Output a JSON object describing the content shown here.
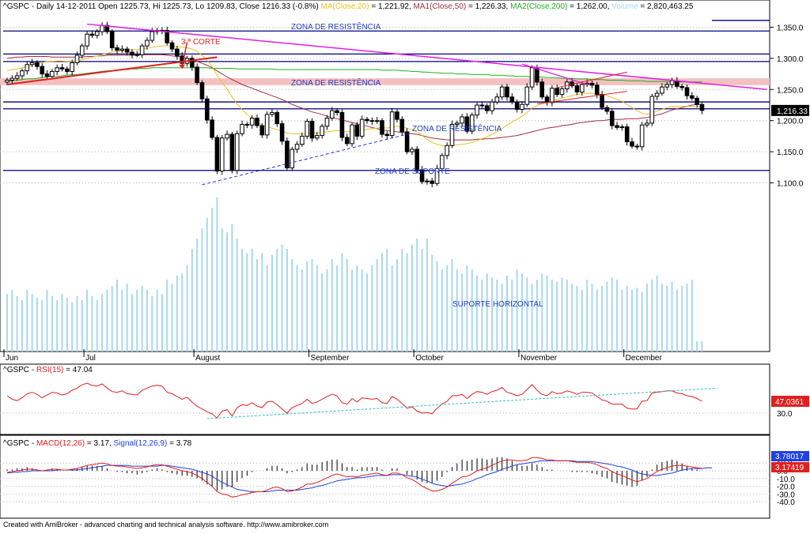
{
  "header": {
    "price": {
      "symbol": "^GSPC",
      "sep1": " - ",
      "period": "Daily",
      "date": "14-12-2011",
      "open": "Open 1225.73,",
      "hi": "Hi 1225.73,",
      "lo": "Lo 1209.83,",
      "close": "Close 1216.33 (-0.8%)",
      "ma": "MA(Close,20)",
      "ma_val": "= 1,221.92,",
      "ma1": "MA1(Close,50)",
      "ma1_val": "= 1,226.33,",
      "ma2": "MA2(Close,200)",
      "ma2_val": "= 1,262.00,",
      "vol": "Volume",
      "vol_val": "= 2,820,463.25"
    },
    "rsi": {
      "symbol": "^GSPC",
      "sep": " - ",
      "label": "RSI(15)",
      "val": "= 47.04"
    },
    "macd": {
      "symbol": "^GSPC",
      "sep": " - ",
      "label": "MACD(12,26)",
      "val": "= 3.17,",
      "sig": "Signal(12,26,9)",
      "sig_val": "= 3.78"
    }
  },
  "colors": {
    "candle": "#000000",
    "ma20": "#e8c020",
    "ma50": "#a03040",
    "ma200": "#20b020",
    "volume": "#a8d8f0",
    "resistance_line": "#000080",
    "trend_pink": "#e020e0",
    "trend_red": "#e02020",
    "zone_fill": "#f4c0c0",
    "rsi": "#e02020",
    "rsi_trend": "#30c0c0",
    "macd": "#e02020",
    "signal": "#2040e0",
    "hist": "#000000"
  },
  "annotations": {
    "zone_res_1": "ZONA DE RESISTÊNCIA",
    "zone_res_2": "ZONA DE RESISTÊNCIA",
    "zone_res_3": "ZONA DE RESISTÊNCIA",
    "zone_sup": "ZONA DE SUPORTE",
    "sup_horiz": "SUPORTE HORIZONTAL",
    "corte": "3.ª CORTE"
  },
  "footer": "Created with AmiBroker - advanced charting and technical analysis software. http://www.amibroker.com",
  "chart_data": [
    {
      "type": "candlestick",
      "pane": "price",
      "ylim": [
        1070,
        1370
      ],
      "yticks": [
        "1,350.0",
        "1,300.0",
        "1,250.0",
        "1,200.0",
        "1,150.0",
        "1,100.0"
      ],
      "ytick_values": [
        1350,
        1300,
        1250,
        1200,
        1150,
        1100
      ],
      "last_price_label": "1,216.33",
      "last_price": 1216.33,
      "month_labels": [
        "Jun",
        "Jul",
        "August",
        "September",
        "October",
        "November",
        "December"
      ],
      "month_start_index": [
        0,
        16,
        38,
        61,
        82,
        103,
        124
      ],
      "closes": [
        1265,
        1268,
        1272,
        1280,
        1290,
        1293,
        1287,
        1275,
        1271,
        1279,
        1285,
        1283,
        1279,
        1293,
        1305,
        1320,
        1339,
        1337,
        1343,
        1353,
        1343,
        1317,
        1313,
        1315,
        1310,
        1306,
        1306,
        1320,
        1329,
        1343,
        1345,
        1345,
        1325,
        1315,
        1304,
        1292,
        1300,
        1286,
        1261,
        1235,
        1201,
        1173,
        1119,
        1172,
        1178,
        1120,
        1179,
        1194,
        1193,
        1204,
        1192,
        1177,
        1210,
        1213,
        1195,
        1167,
        1124,
        1154,
        1162,
        1175,
        1199,
        1172,
        1176,
        1191,
        1204,
        1216,
        1213,
        1173,
        1163,
        1193,
        1175,
        1202,
        1200,
        1199,
        1200,
        1178,
        1176,
        1214,
        1202,
        1182,
        1150,
        1154,
        1121,
        1102,
        1103,
        1099,
        1123,
        1144,
        1160,
        1194,
        1196,
        1206,
        1183,
        1209,
        1225,
        1224,
        1216,
        1230,
        1238,
        1254,
        1238,
        1230,
        1218,
        1226,
        1254,
        1285,
        1262,
        1238,
        1229,
        1252,
        1242,
        1251,
        1262,
        1256,
        1246,
        1258,
        1260,
        1257,
        1242,
        1221,
        1215,
        1192,
        1189,
        1190,
        1166,
        1159,
        1158,
        1193,
        1196,
        1239,
        1244,
        1254,
        1258,
        1264,
        1255,
        1253,
        1240,
        1236,
        1226,
        1216.33
      ],
      "ma20": [
        1280,
        1282,
        1283,
        1285,
        1287,
        1290,
        1292,
        1293,
        1295,
        1295,
        1296,
        1296,
        1295,
        1295,
        1296,
        1298,
        1300,
        1302,
        1304,
        1306,
        1308,
        1310,
        1311,
        1312,
        1313,
        1314,
        1314,
        1315,
        1316,
        1318,
        1319,
        1320,
        1320,
        1320,
        1319,
        1318,
        1317,
        1315,
        1311,
        1305,
        1297,
        1287,
        1273,
        1261,
        1251,
        1238,
        1227,
        1218,
        1210,
        1204,
        1198,
        1192,
        1190,
        1188,
        1186,
        1183,
        1180,
        1179,
        1179,
        1178,
        1179,
        1180,
        1180,
        1181,
        1182,
        1183,
        1184,
        1183,
        1182,
        1182,
        1182,
        1184,
        1186,
        1187,
        1188,
        1189,
        1188,
        1190,
        1191,
        1190,
        1188,
        1186,
        1182,
        1176,
        1170,
        1165,
        1162,
        1160,
        1159,
        1160,
        1161,
        1162,
        1163,
        1165,
        1168,
        1171,
        1174,
        1178,
        1182,
        1187,
        1193,
        1198,
        1202,
        1207,
        1213,
        1220,
        1224,
        1227,
        1229,
        1232,
        1234,
        1236,
        1238,
        1240,
        1242,
        1243,
        1244,
        1244,
        1243,
        1242,
        1240,
        1237,
        1234,
        1231,
        1226,
        1221,
        1216,
        1212,
        1210,
        1212,
        1215,
        1218,
        1221,
        1223,
        1223,
        1223,
        1223,
        1223,
        1222,
        1221.92
      ],
      "ma50": [
        1300,
        1301,
        1302,
        1302,
        1303,
        1303,
        1303,
        1303,
        1303,
        1302,
        1302,
        1302,
        1302,
        1302,
        1302,
        1302,
        1303,
        1303,
        1304,
        1304,
        1305,
        1305,
        1305,
        1305,
        1305,
        1305,
        1305,
        1306,
        1306,
        1306,
        1306,
        1306,
        1305,
        1304,
        1303,
        1302,
        1300,
        1298,
        1295,
        1292,
        1289,
        1285,
        1280,
        1275,
        1270,
        1266,
        1262,
        1258,
        1255,
        1252,
        1249,
        1246,
        1243,
        1240,
        1237,
        1234,
        1230,
        1226,
        1223,
        1220,
        1217,
        1214,
        1212,
        1210,
        1207,
        1205,
        1203,
        1201,
        1199,
        1197,
        1195,
        1193,
        1191,
        1189,
        1187,
        1185,
        1184,
        1183,
        1182,
        1181,
        1180,
        1179,
        1178,
        1176,
        1174,
        1172,
        1171,
        1170,
        1169,
        1169,
        1169,
        1169,
        1169,
        1169,
        1170,
        1170,
        1171,
        1171,
        1172,
        1173,
        1174,
        1175,
        1176,
        1178,
        1180,
        1182,
        1184,
        1186,
        1188,
        1189,
        1190,
        1192,
        1193,
        1194,
        1196,
        1197,
        1198,
        1199,
        1200,
        1200,
        1201,
        1202,
        1202,
        1202,
        1203,
        1203,
        1203,
        1204,
        1205,
        1207,
        1209,
        1211,
        1214,
        1217,
        1219,
        1221,
        1223,
        1225,
        1226,
        1226.33
      ],
      "ma200": [
        1263,
        1264,
        1265,
        1266,
        1267,
        1267,
        1268,
        1269,
        1270,
        1271,
        1271,
        1272,
        1273,
        1274,
        1274,
        1275,
        1276,
        1277,
        1278,
        1279,
        1280,
        1280,
        1281,
        1282,
        1282,
        1283,
        1283,
        1284,
        1284,
        1285,
        1285,
        1285,
        1285,
        1285,
        1285,
        1285,
        1285,
        1285,
        1285,
        1285,
        1285,
        1284,
        1284,
        1284,
        1284,
        1284,
        1283,
        1283,
        1283,
        1283,
        1283,
        1283,
        1283,
        1283,
        1282,
        1282,
        1282,
        1282,
        1282,
        1282,
        1282,
        1282,
        1282,
        1282,
        1282,
        1282,
        1282,
        1282,
        1282,
        1282,
        1282,
        1282,
        1282,
        1282,
        1282,
        1281,
        1281,
        1281,
        1281,
        1280,
        1280,
        1279,
        1279,
        1278,
        1278,
        1277,
        1277,
        1276,
        1276,
        1276,
        1275,
        1275,
        1275,
        1274,
        1274,
        1274,
        1274,
        1273,
        1273,
        1273,
        1272,
        1272,
        1271,
        1271,
        1271,
        1270,
        1270,
        1270,
        1269,
        1269,
        1269,
        1268,
        1268,
        1268,
        1267,
        1267,
        1267,
        1266,
        1266,
        1266,
        1265,
        1265,
        1265,
        1265,
        1264,
        1264,
        1264,
        1264,
        1263,
        1263,
        1263,
        1263,
        1263,
        1262,
        1262,
        1262,
        1262,
        1262,
        1262,
        1262.0
      ],
      "volume_relative": [
        0.28,
        0.3,
        0.27,
        0.25,
        0.3,
        0.28,
        0.26,
        0.25,
        0.3,
        0.27,
        0.25,
        0.28,
        0.26,
        0.24,
        0.27,
        0.25,
        0.3,
        0.27,
        0.25,
        0.28,
        0.3,
        0.32,
        0.35,
        0.3,
        0.33,
        0.28,
        0.3,
        0.32,
        0.3,
        0.27,
        0.3,
        0.28,
        0.35,
        0.33,
        0.37,
        0.38,
        0.42,
        0.5,
        0.55,
        0.6,
        0.65,
        0.7,
        0.75,
        0.6,
        0.58,
        0.62,
        0.55,
        0.5,
        0.48,
        0.5,
        0.45,
        0.48,
        0.42,
        0.47,
        0.5,
        0.52,
        0.5,
        0.45,
        0.42,
        0.4,
        0.44,
        0.45,
        0.42,
        0.38,
        0.4,
        0.45,
        0.42,
        0.48,
        0.45,
        0.4,
        0.42,
        0.4,
        0.38,
        0.42,
        0.45,
        0.48,
        0.5,
        0.42,
        0.45,
        0.5,
        0.48,
        0.52,
        0.55,
        0.5,
        0.55,
        0.47,
        0.44,
        0.4,
        0.42,
        0.45,
        0.4,
        0.38,
        0.42,
        0.4,
        0.37,
        0.35,
        0.38,
        0.36,
        0.35,
        0.33,
        0.37,
        0.35,
        0.4,
        0.38,
        0.36,
        0.33,
        0.35,
        0.38,
        0.37,
        0.35,
        0.34,
        0.36,
        0.35,
        0.33,
        0.32,
        0.3,
        0.35,
        0.33,
        0.3,
        0.32,
        0.34,
        0.36,
        0.35,
        0.3,
        0.32,
        0.3,
        0.31,
        0.29,
        0.33,
        0.35,
        0.37,
        0.33,
        0.32,
        0.34,
        0.3,
        0.32,
        0.33,
        0.35,
        0.05,
        0.05
      ]
    },
    {
      "type": "line",
      "pane": "rsi",
      "ylim": [
        20,
        80
      ],
      "yticks": [
        "30.0"
      ],
      "ytick_values": [
        30
      ],
      "last_value_label": "47.0361",
      "rsi": [
        55,
        50,
        48,
        52,
        58,
        60,
        57,
        52,
        56,
        60,
        59,
        56,
        58,
        63,
        66,
        71,
        73,
        70,
        69,
        72,
        66,
        61,
        60,
        62,
        58,
        57,
        56,
        63,
        66,
        69,
        70,
        69,
        60,
        58,
        54,
        50,
        53,
        46,
        40,
        36,
        32,
        29,
        23,
        33,
        35,
        26,
        38,
        42,
        41,
        45,
        40,
        38,
        46,
        47,
        42,
        36,
        30,
        38,
        41,
        44,
        50,
        44,
        46,
        50,
        54,
        57,
        55,
        45,
        43,
        51,
        46,
        52,
        51,
        50,
        51,
        45,
        44,
        54,
        50,
        44,
        37,
        39,
        33,
        30,
        31,
        29,
        37,
        43,
        47,
        55,
        55,
        57,
        51,
        57,
        61,
        60,
        57,
        61,
        63,
        67,
        60,
        58,
        55,
        57,
        64,
        71,
        63,
        57,
        55,
        61,
        58,
        59,
        62,
        60,
        57,
        60,
        60,
        59,
        54,
        49,
        47,
        43,
        43,
        43,
        37,
        36,
        36,
        47,
        48,
        59,
        60,
        61,
        62,
        62,
        59,
        58,
        55,
        54,
        51,
        47.04
      ],
      "annotation_trendline": "rising"
    },
    {
      "type": "line",
      "pane": "macd",
      "ylim": [
        -45,
        25
      ],
      "yticks": [
        "10.0",
        "0.0",
        "-10.0",
        "-20.0",
        "-30.0",
        "-40.0"
      ],
      "ytick_values": [
        10,
        0,
        -10,
        -20,
        -30,
        -40
      ],
      "macd_label": "3.78017",
      "signal_label": "3.17419",
      "macd": [
        -2,
        -1,
        0,
        1,
        2,
        2,
        1,
        0,
        1,
        2,
        2,
        1,
        1,
        2,
        3,
        5,
        7,
        8,
        9,
        10,
        9,
        7,
        6,
        6,
        5,
        4,
        3,
        4,
        5,
        7,
        8,
        8,
        6,
        4,
        2,
        0,
        -1,
        -3,
        -6,
        -10,
        -15,
        -20,
        -27,
        -30,
        -31,
        -34,
        -33,
        -31,
        -30,
        -28,
        -27,
        -27,
        -25,
        -22,
        -21,
        -23,
        -27,
        -26,
        -24,
        -21,
        -17,
        -17,
        -15,
        -12,
        -9,
        -6,
        -4,
        -6,
        -8,
        -7,
        -8,
        -6,
        -5,
        -4,
        -3,
        -5,
        -6,
        -3,
        -3,
        -5,
        -9,
        -11,
        -15,
        -20,
        -23,
        -26,
        -26,
        -24,
        -21,
        -16,
        -12,
        -8,
        -7,
        -4,
        0,
        2,
        4,
        7,
        10,
        13,
        14,
        14,
        13,
        13,
        14,
        17,
        17,
        16,
        14,
        14,
        13,
        13,
        13,
        12,
        11,
        11,
        11,
        10,
        8,
        5,
        3,
        -1,
        -4,
        -6,
        -9,
        -12,
        -14,
        -12,
        -10,
        -5,
        -1,
        2,
        4,
        6,
        7,
        7,
        6,
        5,
        4,
        3.17
      ],
      "signal": [
        -3,
        -2,
        -2,
        -1,
        -1,
        0,
        0,
        0,
        0,
        0,
        1,
        1,
        1,
        1,
        1,
        2,
        3,
        4,
        5,
        6,
        7,
        7,
        7,
        7,
        7,
        6,
        6,
        6,
        6,
        6,
        6,
        7,
        7,
        6,
        5,
        4,
        3,
        2,
        0,
        -2,
        -4,
        -7,
        -11,
        -15,
        -18,
        -21,
        -24,
        -25,
        -26,
        -27,
        -27,
        -27,
        -27,
        -26,
        -25,
        -25,
        -25,
        -25,
        -25,
        -24,
        -23,
        -22,
        -20,
        -19,
        -17,
        -15,
        -13,
        -12,
        -11,
        -10,
        -9,
        -9,
        -8,
        -7,
        -6,
        -6,
        -6,
        -5,
        -5,
        -5,
        -6,
        -7,
        -8,
        -11,
        -13,
        -16,
        -18,
        -19,
        -20,
        -19,
        -18,
        -17,
        -15,
        -13,
        -10,
        -8,
        -5,
        -3,
        -1,
        2,
        4,
        6,
        8,
        9,
        10,
        11,
        12,
        13,
        13,
        13,
        13,
        13,
        13,
        13,
        12,
        12,
        12,
        12,
        11,
        10,
        9,
        8,
        6,
        5,
        3,
        1,
        -2,
        -4,
        -5,
        -6,
        -6,
        -5,
        -4,
        -3,
        -1,
        1,
        2,
        3,
        3,
        3,
        4,
        3.78
      ]
    }
  ]
}
